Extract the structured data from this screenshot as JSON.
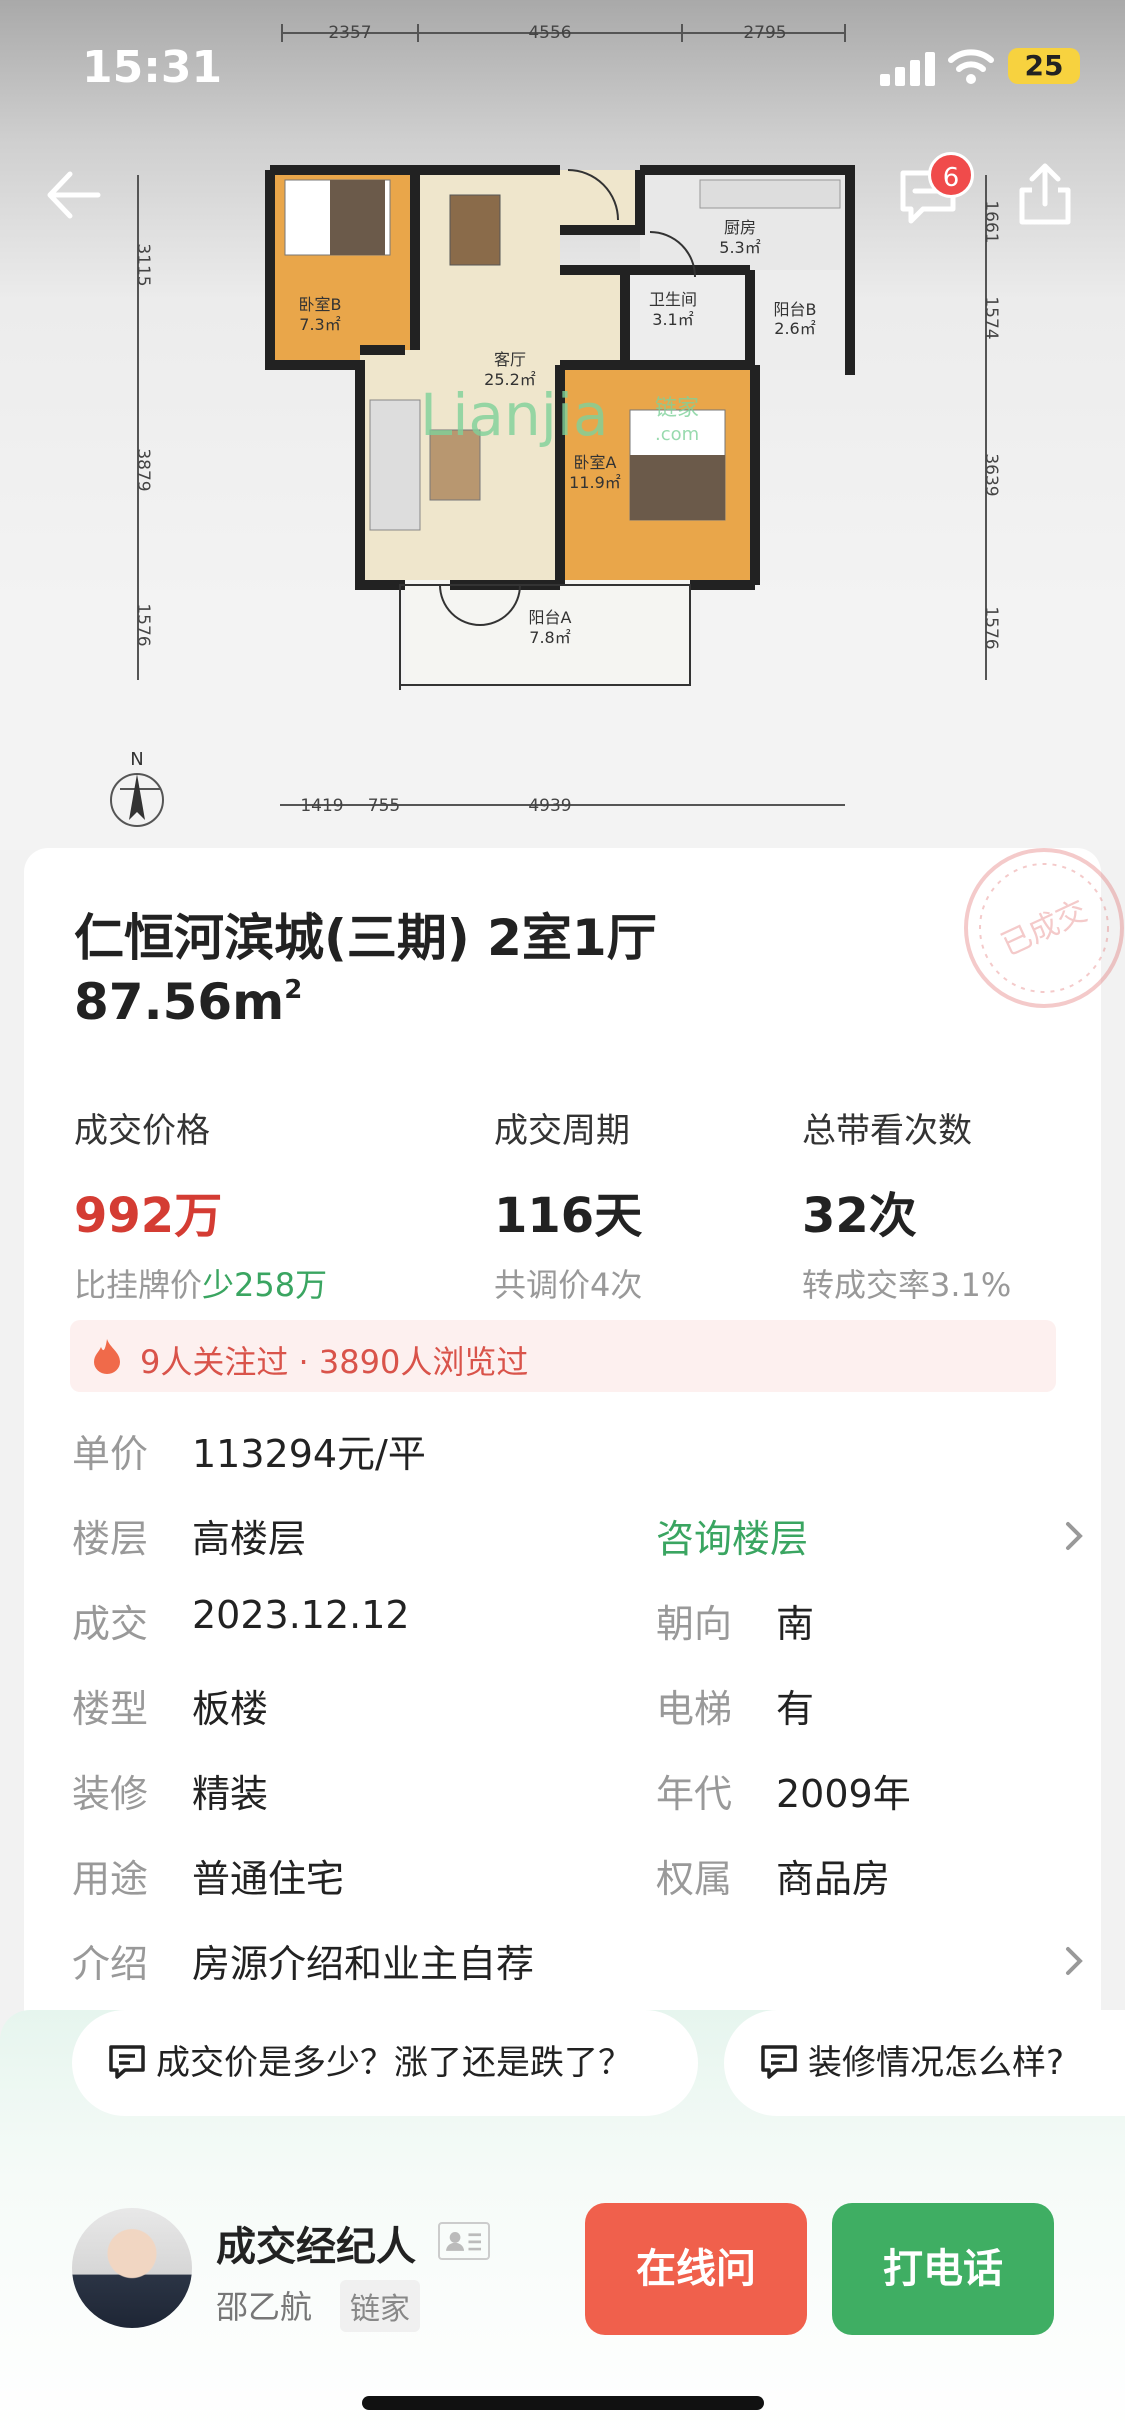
{
  "status_bar": {
    "time": "15:31",
    "battery": "25"
  },
  "nav": {
    "message_badge": "6"
  },
  "floor_plan": {
    "rooms": [
      {
        "name": "卧室B",
        "area": "7.3㎡"
      },
      {
        "name": "厨房",
        "area": "5.3㎡"
      },
      {
        "name": "卫生间",
        "area": "3.1㎡"
      },
      {
        "name": "阳台B",
        "area": "2.6㎡"
      },
      {
        "name": "客厅",
        "area": "25.2㎡"
      },
      {
        "name": "卧室A",
        "area": "11.9㎡"
      },
      {
        "name": "阳台A",
        "area": "7.8㎡"
      }
    ],
    "dims_top": [
      "2357",
      "4556",
      "2795"
    ],
    "dims_left": [
      "3115",
      "3879",
      "1576"
    ],
    "dims_right": [
      "1661",
      "1574",
      "3639",
      "1576"
    ],
    "dims_bottom": [
      "1419",
      "755",
      "4939"
    ],
    "compass": "N",
    "watermark": "Lianjia",
    "watermark_cn": "链家",
    "watermark_com": ".com"
  },
  "listing": {
    "title": "仁恒河滨城(三期) 2室1厅",
    "area": "87.56m",
    "area_sup": "2",
    "stamp": "已成交"
  },
  "stats": [
    {
      "label": "成交价格",
      "value": "992万",
      "sub_prefix": "比挂牌价",
      "sub_highlight": "少258万"
    },
    {
      "label": "成交周期",
      "value": "116天",
      "sub": "共调价4次"
    },
    {
      "label": "总带看次数",
      "value": "32次",
      "sub": "转成交率3.1%"
    }
  ],
  "notice": "9人关注过 · 3890人浏览过",
  "details": {
    "unit_price_label": "单价",
    "unit_price": "113294元/平",
    "floor_label": "楼层",
    "floor": "高楼层",
    "floor_link": "咨询楼层",
    "deal_label": "成交",
    "deal_date": "2023.12.12",
    "orientation_label": "朝向",
    "orientation": "南",
    "building_type_label": "楼型",
    "building_type": "板楼",
    "elevator_label": "电梯",
    "elevator": "有",
    "decoration_label": "装修",
    "decoration": "精装",
    "year_label": "年代",
    "year": "2009年",
    "usage_label": "用途",
    "usage": "普通住宅",
    "ownership_label": "权属",
    "ownership": "商品房",
    "intro_label": "介绍",
    "intro": "房源介绍和业主自荐"
  },
  "questions": [
    "成交价是多少？涨了还是跌了？",
    "装修情况怎么样?"
  ],
  "agent": {
    "role": "成交经纪人",
    "name": "邵乙航",
    "company": "链家"
  },
  "actions": {
    "online": "在线问",
    "call": "打电话"
  },
  "colors": {
    "price_red": "#d43c33",
    "green": "#3aa561",
    "btn_red": "#f0604c",
    "btn_green": "#3fae63"
  }
}
